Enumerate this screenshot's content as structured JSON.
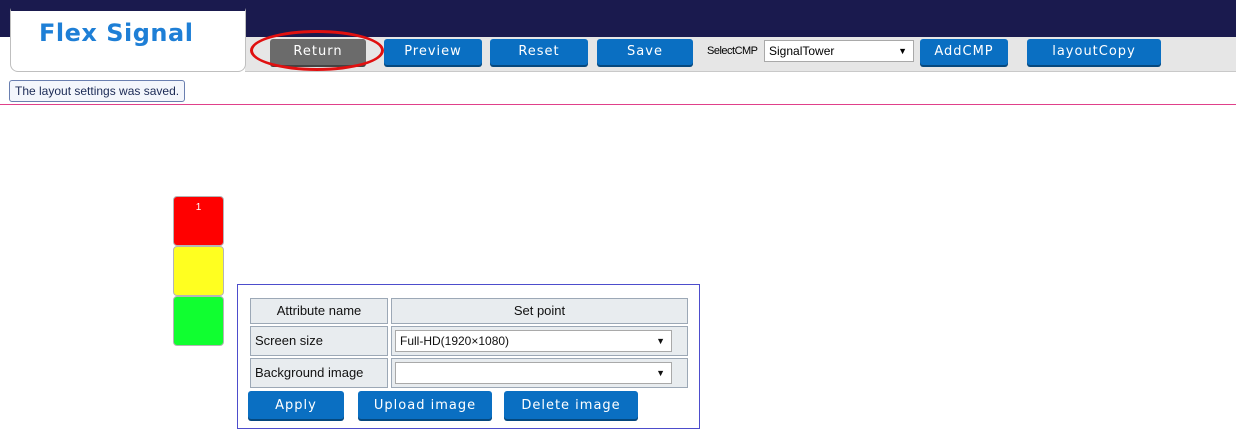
{
  "app": {
    "logo_text": "Flex Signal"
  },
  "toolbar": {
    "return_label": "Return",
    "preview_label": "Preview",
    "reset_label": "Reset",
    "save_label": "Save",
    "select_cmp_label": "SelectCMP",
    "select_cmp_value": "SignalTower",
    "add_cmp_label": "AddCMP",
    "layout_copy_label": "layoutCopy"
  },
  "status": {
    "message": "The layout settings was saved."
  },
  "signal_tower": {
    "lamps": [
      {
        "number": "1",
        "color": "#ff0000"
      },
      {
        "color": "#ffff20"
      },
      {
        "color": "#10ff30"
      }
    ]
  },
  "attribute_panel": {
    "header_name": "Attribute name",
    "header_value": "Set point",
    "rows": [
      {
        "name": "Screen size",
        "value": "Full-HD(1920×1080)"
      },
      {
        "name": "Background image",
        "value": ""
      }
    ],
    "apply_label": "Apply",
    "upload_label": "Upload image",
    "delete_label": "Delete image"
  },
  "colors": {
    "topbar": "#1a1a4e",
    "button": "#0a6fc2",
    "return_button": "#6b6b6b",
    "highlight": "#e01010",
    "divider": "#e0408a"
  }
}
